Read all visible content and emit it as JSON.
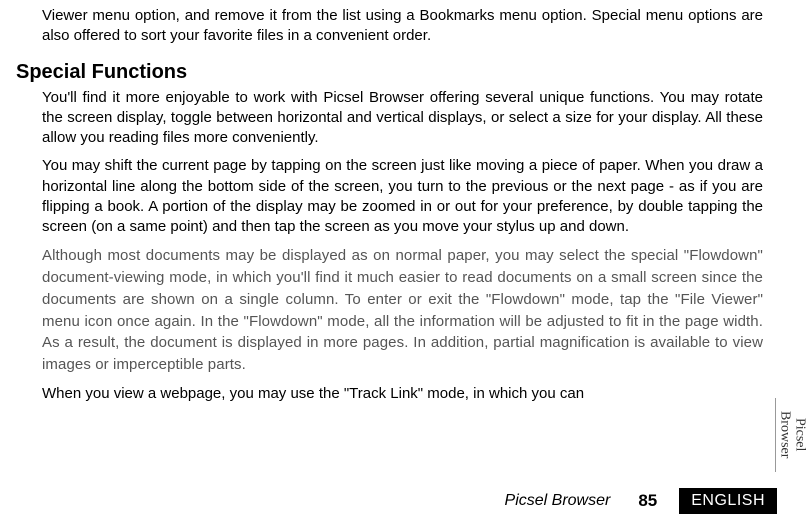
{
  "paragraphs": {
    "p0": "Viewer menu option, and remove it from the list using a Bookmarks menu option. Special menu options are also offered to sort your favorite files in a convenient order.",
    "heading": "Special Functions",
    "p1": "You'll find it more enjoyable to work with Picsel Browser offering several unique functions. You may rotate the screen display, toggle between horizontal and vertical displays, or select a size for your display. All these allow you reading files more conveniently.",
    "p2": "You may shift the current page by tapping on the screen just like moving a piece of paper. When you draw a horizontal line along the bottom side of the screen, you turn to the previous or the next page - as if you are flipping a book. A portion of the display may be zoomed in or out for your preference, by double tapping the screen (on a same point) and then tap the screen as you move your stylus up and down.",
    "p3": "Although most documents may be displayed as on normal paper, you may select the special \"Flowdown\" document-viewing mode, in which you'll find it much easier to read documents on a small screen since the documents are shown on a single column. To enter or exit the \"Flowdown\" mode, tap the \"File Viewer\" menu icon once again. In the \"Flowdown\" mode, all the information will be adjusted to fit in the page width. As a result, the document is displayed in more pages. In addition, partial magnification is available to view images or imperceptible parts.",
    "p4": "When you view a webpage, you may use the \"Track Link\" mode, in which you can"
  },
  "side_tab": {
    "line1": "Picsel",
    "line2": "Browser"
  },
  "footer": {
    "title": "Picsel Browser",
    "page": "85",
    "lang": "ENGLISH"
  }
}
